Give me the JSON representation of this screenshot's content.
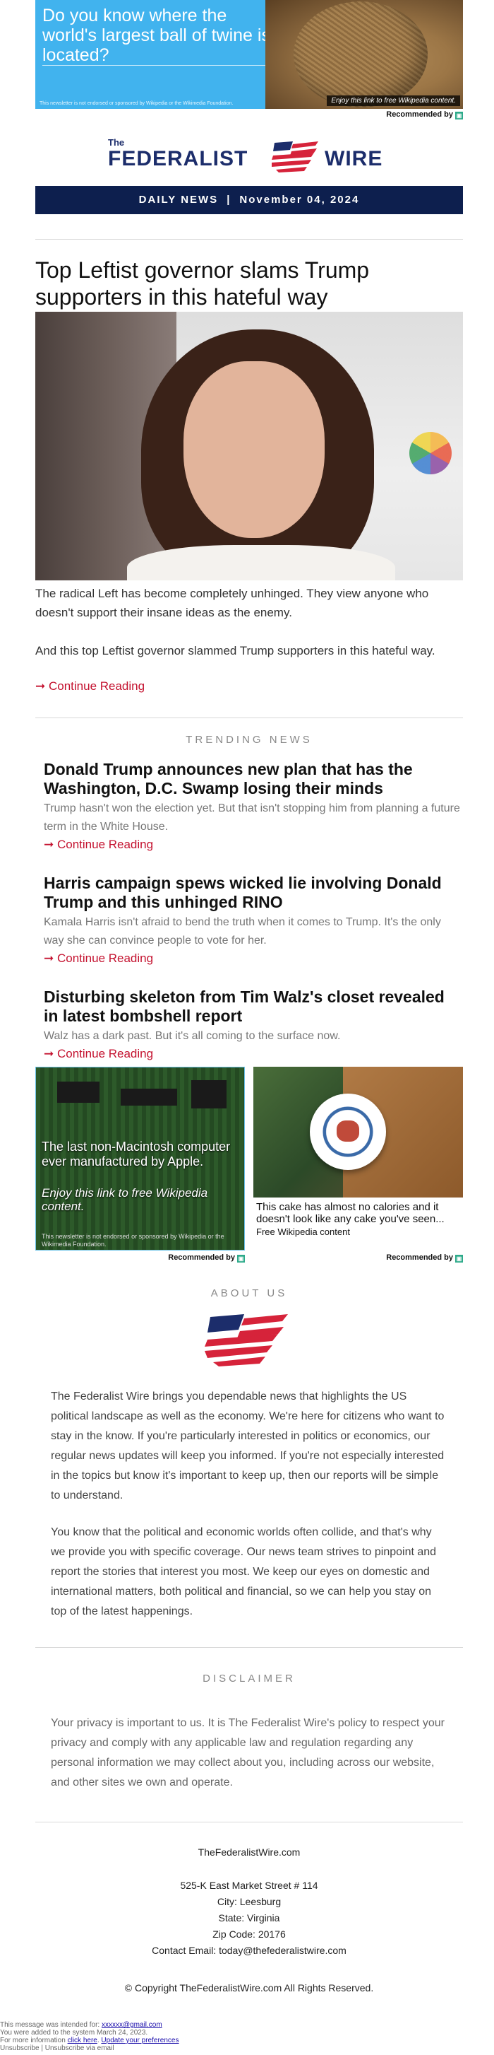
{
  "top_ad": {
    "headline": "Do you know where the world's largest ball of twine is located?",
    "disclaimer": "This newsletter is not endorsed or sponsored by Wikipedia or the Wikimedia Foundation.",
    "enjoy": "Enjoy this link to free Wikipedia content.",
    "recommended": "Recommended by"
  },
  "logo": {
    "the": "The",
    "left": "FEDERALIST",
    "right": "WIRE"
  },
  "date_bar": {
    "label": "DAILY NEWS",
    "separator": "|",
    "date": "November 04, 2024"
  },
  "main_story": {
    "title": "Top Leftist governor slams Trump supporters in this hateful way",
    "para1": "The radical Left has become completely unhinged. They view anyone who doesn't support their insane ideas as the enemy.",
    "para2": "And this top Leftist governor slammed Trump supporters in this hateful way.",
    "continue": "➞ Continue Reading"
  },
  "trending": {
    "label": "TRENDING NEWS",
    "items": [
      {
        "title": "Donald Trump announces new plan that has the Washington, D.C. Swamp losing their minds",
        "summary": "Trump hasn't won the election yet. But that isn't stopping him from planning a future term in the White House.",
        "continue": "➞ Continue Reading"
      },
      {
        "title": "Harris campaign spews wicked lie involving Donald Trump and this unhinged RINO",
        "summary": "Kamala Harris isn't afraid to bend the truth when it comes to Trump. It's the only way she can convince people to vote for her.",
        "continue": "➞ Continue Reading"
      },
      {
        "title": "Disturbing skeleton from Tim Walz's closet revealed in latest bombshell report",
        "summary": "Walz has a dark past. But it's all coming to the surface now.",
        "continue": "➞ Continue Reading"
      }
    ]
  },
  "ad_left": {
    "text": "The last non-Macintosh computer ever manufactured by Apple.",
    "enjoy": "Enjoy this link to free Wikipedia content.",
    "disclaimer": "This newsletter is not endorsed or sponsored by Wikipedia or the Wikimedia Foundation.",
    "recommended": "Recommended by"
  },
  "ad_right": {
    "caption": "This cake has almost no calories and it doesn't look like any cake you've seen...",
    "source": "Free Wikipedia content",
    "recommended": "Recommended by"
  },
  "about": {
    "label": "ABOUT US",
    "para1": "The Federalist Wire brings you dependable news that highlights the US political landscape as well as the economy. We're here for citizens who want to stay in the know. If you're particularly interested in politics or economics, our regular news updates will keep you informed. If you're not especially interested in the topics but know it's important to keep up, then our reports will be simple to understand.",
    "para2": "You know that the political and economic worlds often collide, and that's why we provide you with specific coverage. Our news team strives to pinpoint and report the stories that interest you most. We keep our eyes on domestic and international matters, both political and financial, so we can help you stay on top of the latest happenings."
  },
  "disclaimer": {
    "label": "DISCLAIMER",
    "text": "Your privacy is important to us. It is The Federalist Wire's policy to respect your privacy and comply with any applicable law and regulation regarding any personal information we may collect about you, including across our website, and other sites we own and operate."
  },
  "footer": {
    "site": "TheFederalistWire.com",
    "street": "525-K East Market Street # 114",
    "city": "City: Leesburg",
    "state": "State: Virginia",
    "zip": "Zip Code: 20176",
    "contact": "Contact Email: today@thefederalistwire.com",
    "copyright": "© Copyright TheFederalistWire.com All Rights Reserved."
  },
  "fine_print": {
    "intended_prefix": "This message was intended for:",
    "intended_email": "xxxxxx@gmail.com",
    "added": "You were added to the system March 24, 2023.",
    "info_prefix": "For more information",
    "click_here": "click here",
    "update_prefs": "Update your preferences",
    "unsubscribe": "Unsubscribe | Unsubscribe via email"
  },
  "colors": {
    "navy": "#0d1f4e",
    "link_red": "#c4122f",
    "ad_blue": "#41b3ee"
  }
}
